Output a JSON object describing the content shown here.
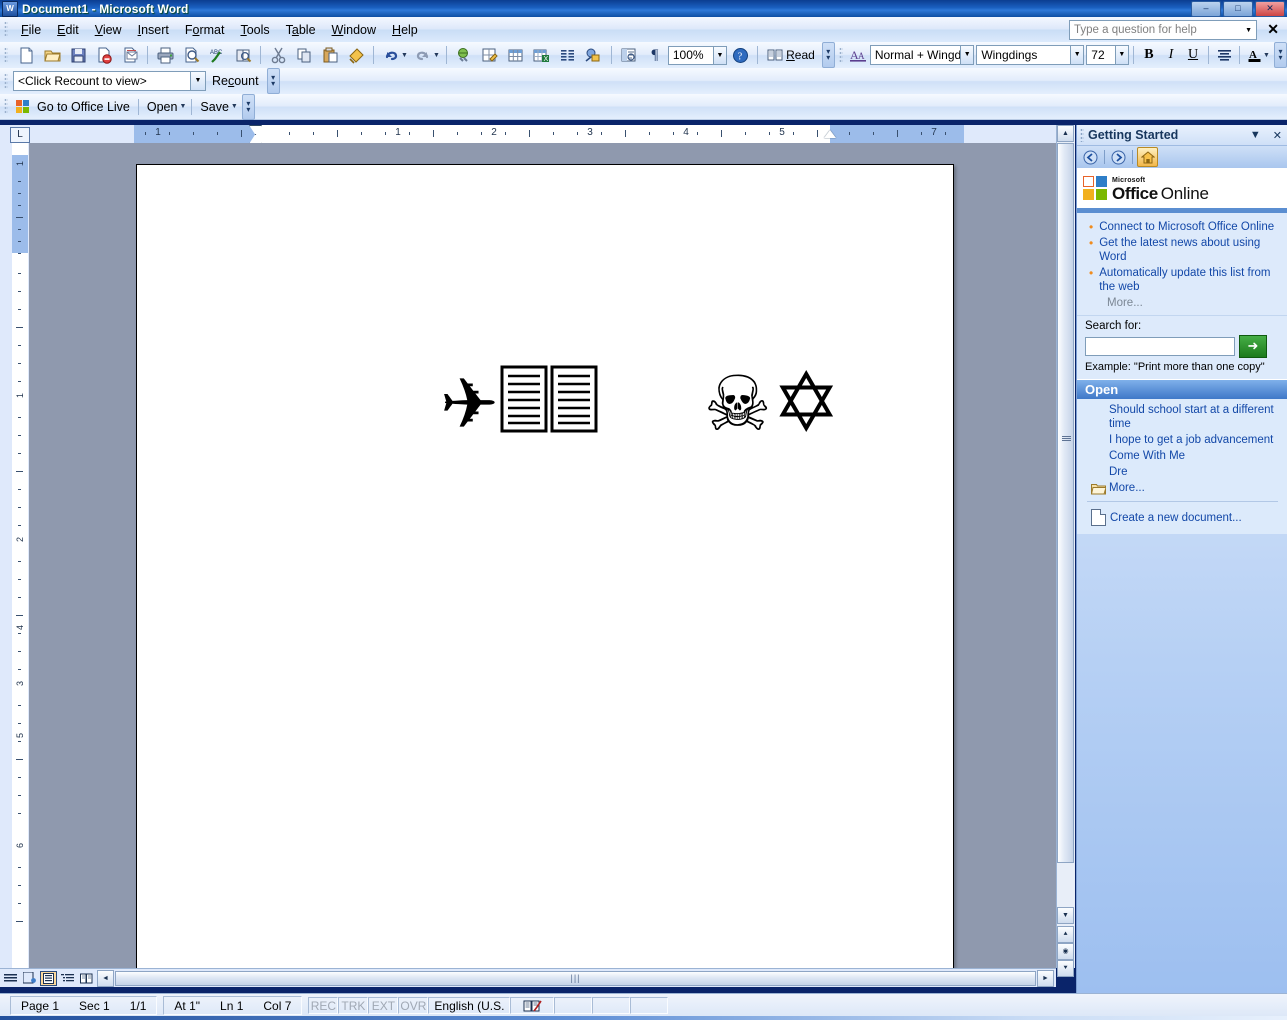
{
  "window": {
    "title": "Document1 - Microsoft Word",
    "app_icon": "word-icon",
    "minimize": "–",
    "maximize": "□",
    "close": "✕"
  },
  "menubar": {
    "items": [
      "File",
      "Edit",
      "View",
      "Insert",
      "Format",
      "Tools",
      "Table",
      "Window",
      "Help"
    ],
    "help_placeholder": "Type a question for help",
    "help_dropdown": "▼",
    "close_label": "✕"
  },
  "standard_toolbar": {
    "buttons": [
      "new-document-icon",
      "open-icon",
      "save-icon",
      "permission-icon",
      "email-icon",
      "print-icon",
      "print-preview-icon",
      "spelling-grammar-icon",
      "research-icon",
      "cut-icon",
      "copy-icon",
      "paste-icon",
      "format-painter-icon",
      "undo-icon",
      "redo-icon",
      "insert-hyperlink-icon",
      "tables-borders-icon",
      "insert-table-icon",
      "insert-excel-worksheet-icon",
      "columns-icon",
      "drawing-icon",
      "document-map-icon",
      "show-formatting-marks-icon"
    ],
    "zoom_value": "100%",
    "zoom_dropdown": "▼",
    "help_icon": "help-icon",
    "read_label": "Read",
    "read_icon": "read-icon",
    "overflow": "»"
  },
  "formatting_toolbar": {
    "styles_icon": "styles-formatting-icon",
    "style_value": "Normal + Wingd",
    "font_value": "Wingdings",
    "size_value": "72",
    "bold": "B",
    "italic": "I",
    "underline": "U",
    "align": "align-icon",
    "font_color": "A",
    "font_color_swatch": "#000000",
    "dropdown": "▼",
    "overflow": "»"
  },
  "recount_toolbar": {
    "combo_value": "<Click Recount to view>",
    "combo_dropdown": "▼",
    "recount_label": "Recount",
    "overflow": "»"
  },
  "office_live_toolbar": {
    "logo_icon": "office-live-icon",
    "go_label": "Go to Office Live",
    "open_label": "Open",
    "save_label": "Save",
    "dropdown": "▼",
    "overflow": "»"
  },
  "ruler": {
    "corner_tab": "L",
    "horizontal_numbers": [
      "1",
      "1",
      "2",
      "3",
      "4",
      "5",
      "7"
    ],
    "vertical_numbers": [
      "1",
      "1",
      "2",
      "3",
      "4",
      "5",
      "6",
      "7"
    ]
  },
  "document": {
    "font": "Wingdings",
    "font_size": "72",
    "glyphs": [
      {
        "name": "airplane-glyph",
        "char": "✈"
      },
      {
        "name": "document-glyph-1",
        "char": "🗎"
      },
      {
        "name": "document-glyph-2",
        "char": "🗎"
      },
      {
        "name": "space-glyph",
        "char": " "
      },
      {
        "name": "skull-crossbones-glyph",
        "char": "☠"
      },
      {
        "name": "star-of-david-glyph",
        "char": "✡"
      }
    ],
    "text": "✈🗎🗎 ☠✡"
  },
  "taskpane": {
    "title": "Getting Started",
    "dropdown": "▼",
    "close": "✕",
    "nav": {
      "back": "back-icon",
      "forward": "forward-icon",
      "home": "home-icon"
    },
    "logo": {
      "microsoft": "Microsoft",
      "office": "Office",
      "online": "Online"
    },
    "links": [
      "Connect to Microsoft Office Online",
      "Get the latest news about using Word",
      "Automatically update this list from the web"
    ],
    "more_label": "More...",
    "search_label": "Search for:",
    "search_value": "",
    "search_go": "➜",
    "example_label": "Example:",
    "example_text": "\"Print more than one copy\"",
    "open_header": "Open",
    "open_files": [
      "Should school start at a different time",
      "I hope to get a job advancement",
      "Come With Me",
      "Dre"
    ],
    "open_more": "More...",
    "create_new": "Create a new document..."
  },
  "statusbar": {
    "page": "Page 1",
    "section": "Sec 1",
    "pages": "1/1",
    "at": "At 1\"",
    "line": "Ln 1",
    "column": "Col 7",
    "rec": "REC",
    "trk": "TRK",
    "ext": "EXT",
    "ovr": "OVR",
    "language": "English (U.S.",
    "spell_icon": "spell-check-icon"
  },
  "view_buttons": [
    "normal-view-icon",
    "web-layout-view-icon",
    "print-layout-view-icon",
    "outline-view-icon",
    "reading-layout-view-icon"
  ],
  "colors": {
    "titlebar": "#1a5fc0",
    "toolbar": "#dceafc",
    "doc_background": "#8f99ae",
    "page": "#ffffff",
    "link": "#1348a8",
    "bullet": "#f08c1e",
    "taskpane_bar": "#3f78c8"
  }
}
